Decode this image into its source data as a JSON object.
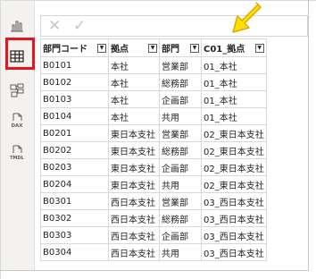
{
  "rail": {
    "items": [
      {
        "name": "report-view-icon"
      },
      {
        "name": "table-view-icon",
        "active": true
      },
      {
        "name": "model-view-icon"
      },
      {
        "name": "dax-query-icon",
        "label": "DAX"
      },
      {
        "name": "tmdl-view-icon",
        "label": "TMDL"
      }
    ]
  },
  "formula_bar": {
    "cancel_glyph": "✕",
    "commit_glyph": "✓",
    "value": ""
  },
  "colors": {
    "highlight": "#e8141b",
    "arrow_fill": "#ffe000",
    "arrow_stroke": "#e0a800",
    "active_indicator": "#117865"
  },
  "table": {
    "columns": [
      "部門コード",
      "拠点",
      "部門",
      "C01_拠点"
    ],
    "rows": [
      [
        "B0101",
        "本社",
        "営業部",
        "01_本社"
      ],
      [
        "B0102",
        "本社",
        "総務部",
        "01_本社"
      ],
      [
        "B0103",
        "本社",
        "企画部",
        "01_本社"
      ],
      [
        "B0104",
        "本社",
        "共用",
        "01_本社"
      ],
      [
        "B0201",
        "東日本支社",
        "営業部",
        "02_東日本支社"
      ],
      [
        "B0202",
        "東日本支社",
        "総務部",
        "02_東日本支社"
      ],
      [
        "B0203",
        "東日本支社",
        "企画部",
        "02_東日本支社"
      ],
      [
        "B0204",
        "東日本支社",
        "共用",
        "02_東日本支社"
      ],
      [
        "B0301",
        "西日本支社",
        "営業部",
        "03_西日本支社"
      ],
      [
        "B0302",
        "西日本支社",
        "総務部",
        "03_西日本支社"
      ],
      [
        "B0303",
        "西日本支社",
        "企画部",
        "03_西日本支社"
      ],
      [
        "B0304",
        "西日本支社",
        "共用",
        "03_西日本支社"
      ]
    ]
  }
}
